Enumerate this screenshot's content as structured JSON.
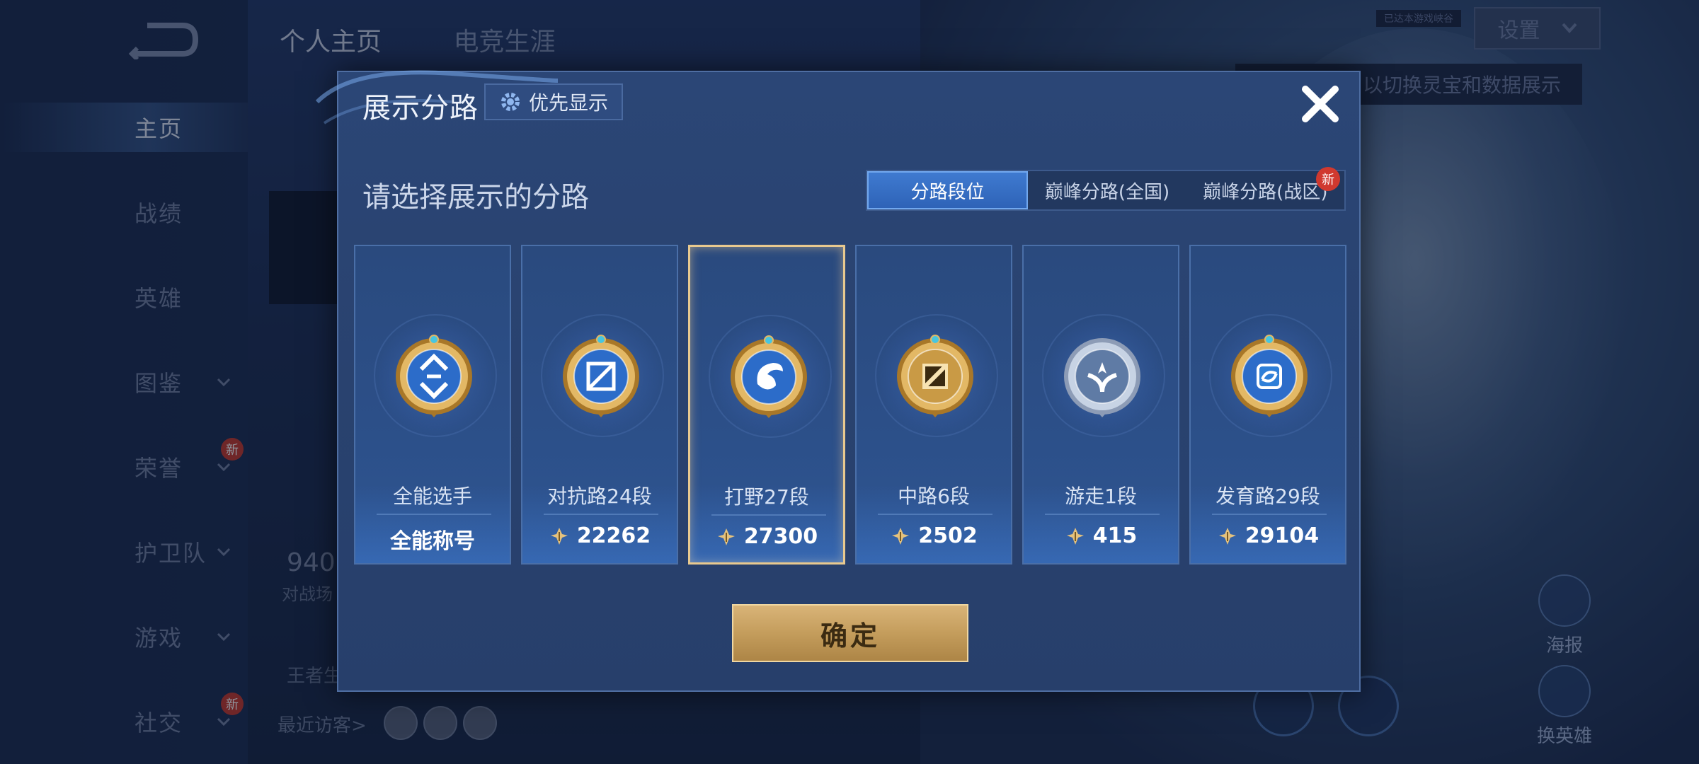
{
  "background": {
    "profile_tabs": [
      "个人主页",
      "电竞生涯"
    ],
    "nav_items": [
      {
        "label": "主页",
        "has_chevron": false,
        "new": false,
        "active": true
      },
      {
        "label": "战绩",
        "has_chevron": false,
        "new": false,
        "active": false
      },
      {
        "label": "英雄",
        "has_chevron": false,
        "new": false,
        "active": false
      },
      {
        "label": "图鉴",
        "has_chevron": true,
        "new": false,
        "active": false
      },
      {
        "label": "荣誉",
        "has_chevron": true,
        "new": true,
        "active": false
      },
      {
        "label": "护卫队",
        "has_chevron": true,
        "new": false,
        "active": false
      },
      {
        "label": "游戏",
        "has_chevron": true,
        "new": false,
        "active": false
      },
      {
        "label": "社交",
        "has_chevron": true,
        "new": true,
        "active": false
      }
    ],
    "new_badge": "新",
    "stat_value": "940",
    "stat_label": "对战场",
    "bottom_label": "王者生",
    "recent_visitors": "最近访客>",
    "settings_label": "设置",
    "hint_text": "以切换灵宝和数据展示",
    "small_tag": "已达本游戏峡谷",
    "right_buttons": [
      "海报",
      "换英雄"
    ]
  },
  "dialog": {
    "title": "展示分路",
    "priority_button": "优先显示",
    "prompt": "请选择展示的分路",
    "tabs": [
      {
        "label": "分路段位",
        "active": true,
        "new": false
      },
      {
        "label": "巅峰分路(全国)",
        "active": false,
        "new": false
      },
      {
        "label": "巅峰分路(战区)",
        "active": false,
        "new": true
      }
    ],
    "new_badge": "新",
    "cards": [
      {
        "name": "全能选手",
        "value": "全能称号",
        "has_points_icon": false,
        "selected": false,
        "emblem": "all-round-emblem-icon"
      },
      {
        "name": "对抗路24段",
        "value": "22262",
        "has_points_icon": true,
        "selected": false,
        "emblem": "clash-lane-emblem-icon"
      },
      {
        "name": "打野27段",
        "value": "27300",
        "has_points_icon": true,
        "selected": true,
        "emblem": "jungle-emblem-icon"
      },
      {
        "name": "中路6段",
        "value": "2502",
        "has_points_icon": true,
        "selected": false,
        "emblem": "mid-lane-emblem-icon"
      },
      {
        "name": "游走1段",
        "value": "415",
        "has_points_icon": true,
        "selected": false,
        "emblem": "roam-emblem-icon"
      },
      {
        "name": "发育路29段",
        "value": "29104",
        "has_points_icon": true,
        "selected": false,
        "emblem": "farm-lane-emblem-icon"
      }
    ],
    "confirm": "确定"
  },
  "colors": {
    "gold": "#e8c98f",
    "tab_active": "#3f7ad0",
    "badge_red": "#d0392f"
  }
}
